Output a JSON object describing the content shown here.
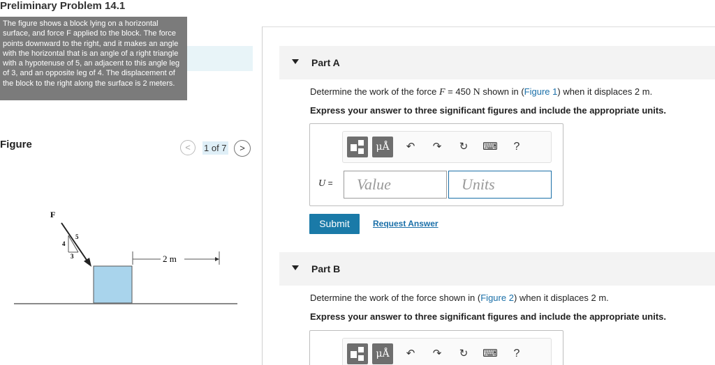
{
  "page": {
    "title": "Preliminary Problem 14.1"
  },
  "tooltip": {
    "text": "The figure shows a block lying on a horizontal surface, and force F applied to the block. The force points downward to the right, and it makes an angle with the horizontal that is an angle of a right triangle with a hypotenuse of 5, an adjacent to this angle leg of 3, and an opposite leg of 4. The displacement of the block to the right along the surface is 2 meters."
  },
  "figure_panel": {
    "label": "Figure",
    "counter": "1 of 7",
    "prev_glyph": "<",
    "next_glyph": ">",
    "diagram": {
      "force_label": "F",
      "leg_opposite": "4",
      "leg_adjacent": "3",
      "hypotenuse": "5",
      "displacement": "2 m"
    }
  },
  "part_a": {
    "title": "Part A",
    "question_prefix": "Determine the work of the force ",
    "question_var": "F",
    "question_eq": " = 450 ",
    "question_unit": "N",
    "question_mid": " shown in (",
    "question_link": "Figure 1",
    "question_suffix": ") when it displaces 2 m.",
    "instruction": "Express your answer to three significant figures and include the appropriate units.",
    "variable": "U",
    "equals": "=",
    "value_placeholder": "Value",
    "units_placeholder": "Units",
    "submit_label": "Submit",
    "request_label": "Request Answer"
  },
  "part_b": {
    "title": "Part B",
    "question_prefix": "Determine the work of the force shown in (",
    "question_link": "Figure 2",
    "question_suffix": ") when it displaces 2 m.",
    "instruction": "Express your answer to three significant figures and include the appropriate units."
  },
  "toolbar": {
    "mu_label": "μÅ",
    "undo_glyph": "↶",
    "redo_glyph": "↷",
    "reset_glyph": "↻",
    "keyboard_glyph": "⌨",
    "help_label": "?"
  },
  "colors": {
    "accent": "#1a7aa8",
    "link": "#1a6fa8",
    "block_fill": "#a9d4ec",
    "tooltip_bg": "#7b7b7b"
  }
}
